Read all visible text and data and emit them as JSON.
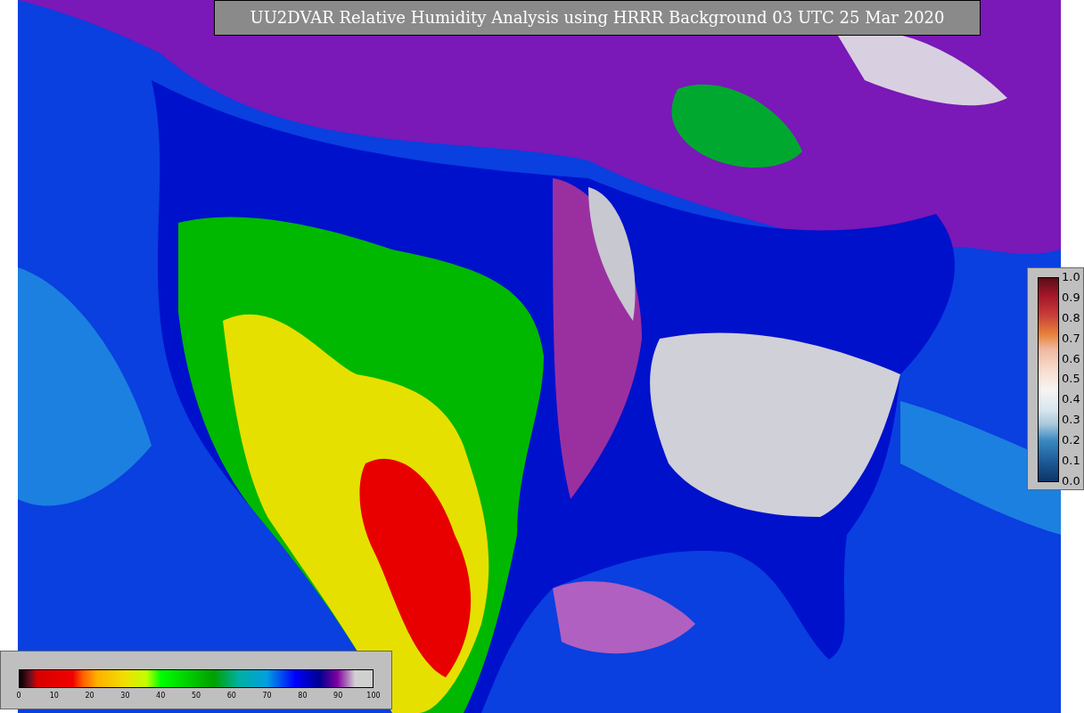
{
  "title": "UU2DVAR Relative Humidity Analysis using HRRR Background 03 UTC 25 Mar 2020",
  "humidity_colorbar": {
    "ticks": [
      "0",
      "10",
      "20",
      "30",
      "40",
      "50",
      "60",
      "70",
      "80",
      "90",
      "100"
    ]
  },
  "observation_colorbar": {
    "ticks": [
      "1.0",
      "0.9",
      "0.8",
      "0.7",
      "0.6",
      "0.5",
      "0.4",
      "0.3",
      "0.2",
      "0.1",
      "0.0"
    ]
  }
}
